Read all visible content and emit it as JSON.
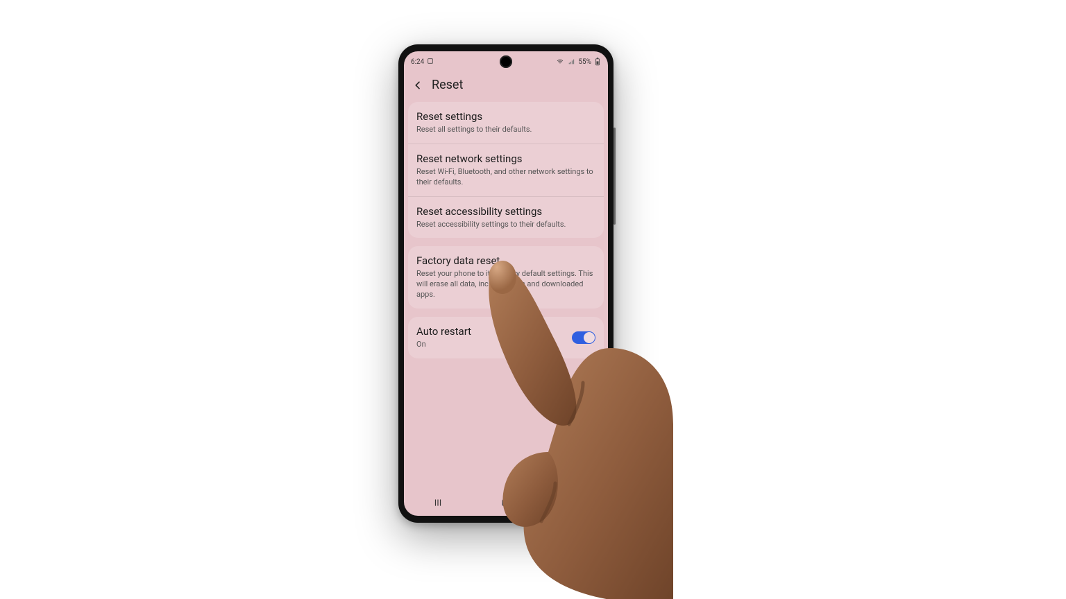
{
  "status": {
    "time": "6:24",
    "battery": "55%"
  },
  "header": {
    "title": "Reset"
  },
  "group1": [
    {
      "title": "Reset settings",
      "desc": "Reset all settings to their defaults."
    },
    {
      "title": "Reset network settings",
      "desc": "Reset Wi-Fi, Bluetooth, and other network settings to their defaults."
    },
    {
      "title": "Reset accessibility settings",
      "desc": "Reset accessibility settings to their defaults."
    }
  ],
  "group2": [
    {
      "title": "Factory data reset",
      "desc": "Reset your phone to its factory default settings. This will erase all data, including files and downloaded apps."
    }
  ],
  "group3": {
    "title": "Auto restart",
    "status": "On",
    "on": true
  }
}
